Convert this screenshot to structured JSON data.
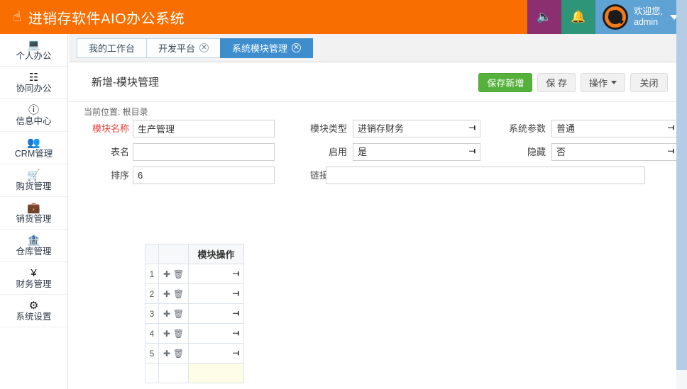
{
  "app": {
    "brand": "进销存软件AIO办公系统",
    "brand_icon": "hand-point-up-icon",
    "colors": {
      "brand_orange": "#F96E00",
      "purple": "#8B2F70",
      "green": "#2E9578",
      "blue": "#5FA2D4",
      "accent_green_button": "#56B13C",
      "tab_active_blue": "#3E8ECE",
      "required_red": "#E8433A"
    }
  },
  "topbar": {
    "speaker_icon": "speaker-icon",
    "bell_icon": "bell-icon",
    "welcome_line1": "欢迎您,",
    "welcome_line2": "admin",
    "avatar_alt": "user-avatar"
  },
  "sidebar": {
    "items": [
      {
        "icon": "desktop-icon",
        "label": "个人办公"
      },
      {
        "icon": "sitemap-icon",
        "label": "协同办公"
      },
      {
        "icon": "info-icon",
        "label": "信息中心"
      },
      {
        "icon": "users-icon",
        "label": "CRM管理"
      },
      {
        "icon": "cart-icon",
        "label": "购货管理"
      },
      {
        "icon": "briefcase-icon",
        "label": "销货管理"
      },
      {
        "icon": "bank-icon",
        "label": "仓库管理"
      },
      {
        "icon": "yen-icon",
        "label": "财务管理"
      },
      {
        "icon": "gear-icon",
        "label": "系统设置"
      }
    ]
  },
  "tabs": [
    {
      "label": "我的工作台",
      "closable": false,
      "active": false
    },
    {
      "label": "开发平台",
      "closable": true,
      "active": false
    },
    {
      "label": "系统模块管理",
      "closable": true,
      "active": true
    }
  ],
  "page": {
    "title": "新增-模块管理",
    "breadcrumb": "当前位置: 根目录"
  },
  "toolbar": {
    "save_new_label": "保存新增",
    "save_label": "保 存",
    "action_label": "操作",
    "close_label": "关闭"
  },
  "form": {
    "module_name": {
      "label": "模块名称",
      "value": "生产管理",
      "required": true
    },
    "table_name": {
      "label": "表名",
      "value": ""
    },
    "sort_order": {
      "label": "排序",
      "value": "6"
    },
    "module_type": {
      "label": "模块类型",
      "value": "进销存财务"
    },
    "enabled": {
      "label": "启用",
      "value": "是"
    },
    "link_url": {
      "label": "链接地址",
      "value": ""
    },
    "sys_param": {
      "label": "系统参数",
      "value": "普通"
    },
    "hidden": {
      "label": "隐藏",
      "value": "否"
    }
  },
  "grid": {
    "headers": {
      "num": "",
      "actions": "",
      "operation": "模块操作"
    },
    "rows": [
      {
        "num": "1",
        "add_icon": "plus-icon",
        "delete_icon": "trash-icon",
        "operation": ""
      },
      {
        "num": "2",
        "add_icon": "plus-icon",
        "delete_icon": "trash-icon",
        "operation": ""
      },
      {
        "num": "3",
        "add_icon": "plus-icon",
        "delete_icon": "trash-icon",
        "operation": ""
      },
      {
        "num": "4",
        "add_icon": "plus-icon",
        "delete_icon": "trash-icon",
        "operation": ""
      },
      {
        "num": "5",
        "add_icon": "plus-icon",
        "delete_icon": "trash-icon",
        "operation": ""
      }
    ],
    "footer": {
      "num": "",
      "actions": "",
      "operation": ""
    }
  }
}
